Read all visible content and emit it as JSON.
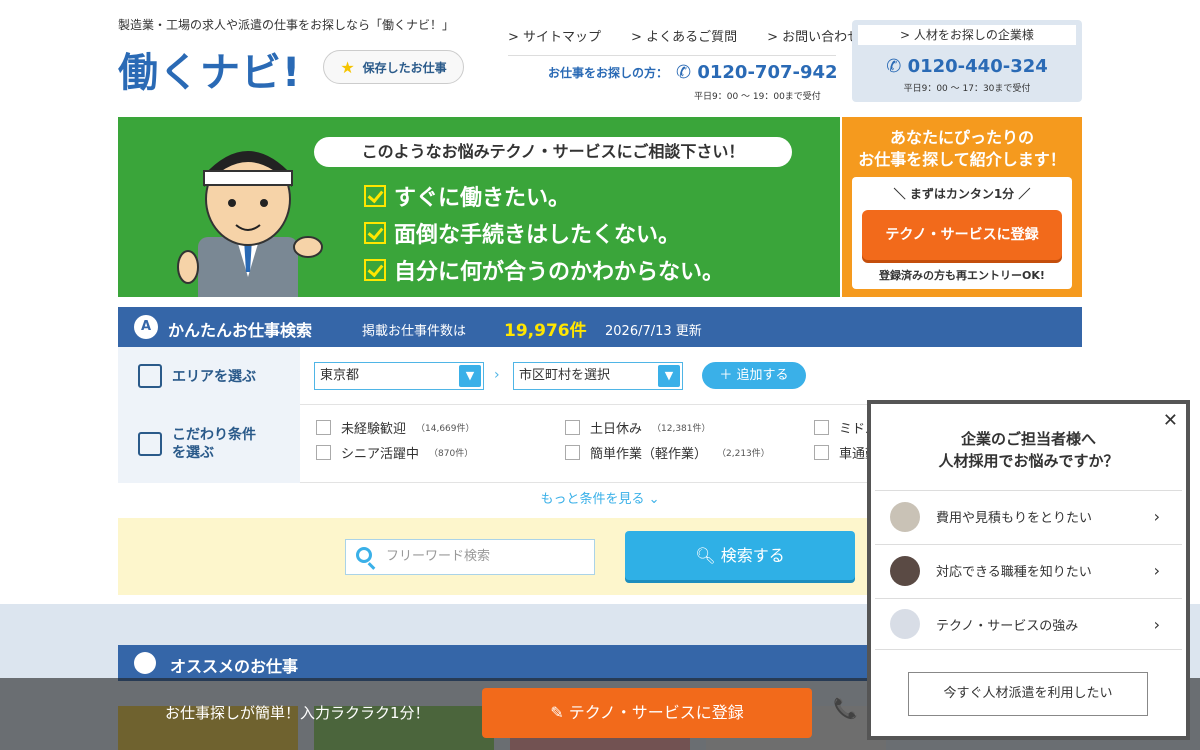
{
  "header": {
    "tagline": "製造業・工場の求人や派遣の仕事をお探しなら「働くナビ！」",
    "logo": "働くナビ!",
    "saved_label": "保存したお仕事",
    "links": [
      "サイトマップ",
      "よくあるご質問",
      "お問い合わせ"
    ],
    "job_seeker_label": "お仕事をお探しの方：",
    "job_seeker_phone": "0120-707-942",
    "job_seeker_hours": "平日9：00 ～ 19：00まで受付",
    "corp_link": "人材をお探しの企業様",
    "corp_phone": "0120-440-324",
    "corp_hours": "平日9：00 ～ 17：30まで受付"
  },
  "banner": {
    "bubble": "このようなお悩みテクノ・サービスにご相談下さい！",
    "checks": [
      "すぐに働きたい。",
      "面倒な手続きはしたくない。",
      "自分に何が合うのかわからない。"
    ],
    "orange_title_1": "あなたにぴったりの",
    "orange_title_2": "お仕事を探して紹介します！",
    "orange_sub": "＼ まずはカンタン1分 ／",
    "register_btn": "テクノ・サービスに登録",
    "orange_note": "登録済みの方も再エントリーOK!"
  },
  "search": {
    "title": "かんたんお仕事検索",
    "count_label": "掲載お仕事件数は",
    "count": "19,976件",
    "updated": "2026/7/13 更新",
    "area_label": "エリアを選ぶ",
    "pref_value": "東京都",
    "city_value": "市区町村を選択",
    "add_btn": "＋ 追加する",
    "cond_label_1": "こだわり条件",
    "cond_label_2": "を選ぶ",
    "conditions": [
      {
        "label": "未経験歓迎",
        "count": "（14,669件）"
      },
      {
        "label": "土日休み",
        "count": "（12,381件）"
      },
      {
        "label": "ミドル",
        "count": ""
      },
      {
        "label": "シニア活躍中",
        "count": "（870件）"
      },
      {
        "label": "簡単作業（軽作業）",
        "count": "（2,213件）"
      },
      {
        "label": "車通勤",
        "count": ""
      }
    ],
    "more": "もっと条件を見る ⌄",
    "free_placeholder": "フリーワード検索",
    "search_btn": "検索する"
  },
  "recommend": {
    "title": "オススメのお仕事"
  },
  "bottom_bar": {
    "message": "お仕事探しが簡単！入力ラクラク1分！",
    "register": "テクノ・サービスに登録",
    "phone_glyph": "📞"
  },
  "popup": {
    "title_1": "企業のご担当者様へ",
    "title_2": "人材採用でお悩みですか？",
    "options": [
      "費用や見積もりをとりたい",
      "対応できる職種を知りたい",
      "テクノ・サービスの強み"
    ],
    "cta": "今すぐ人材派遣を利用したい"
  }
}
